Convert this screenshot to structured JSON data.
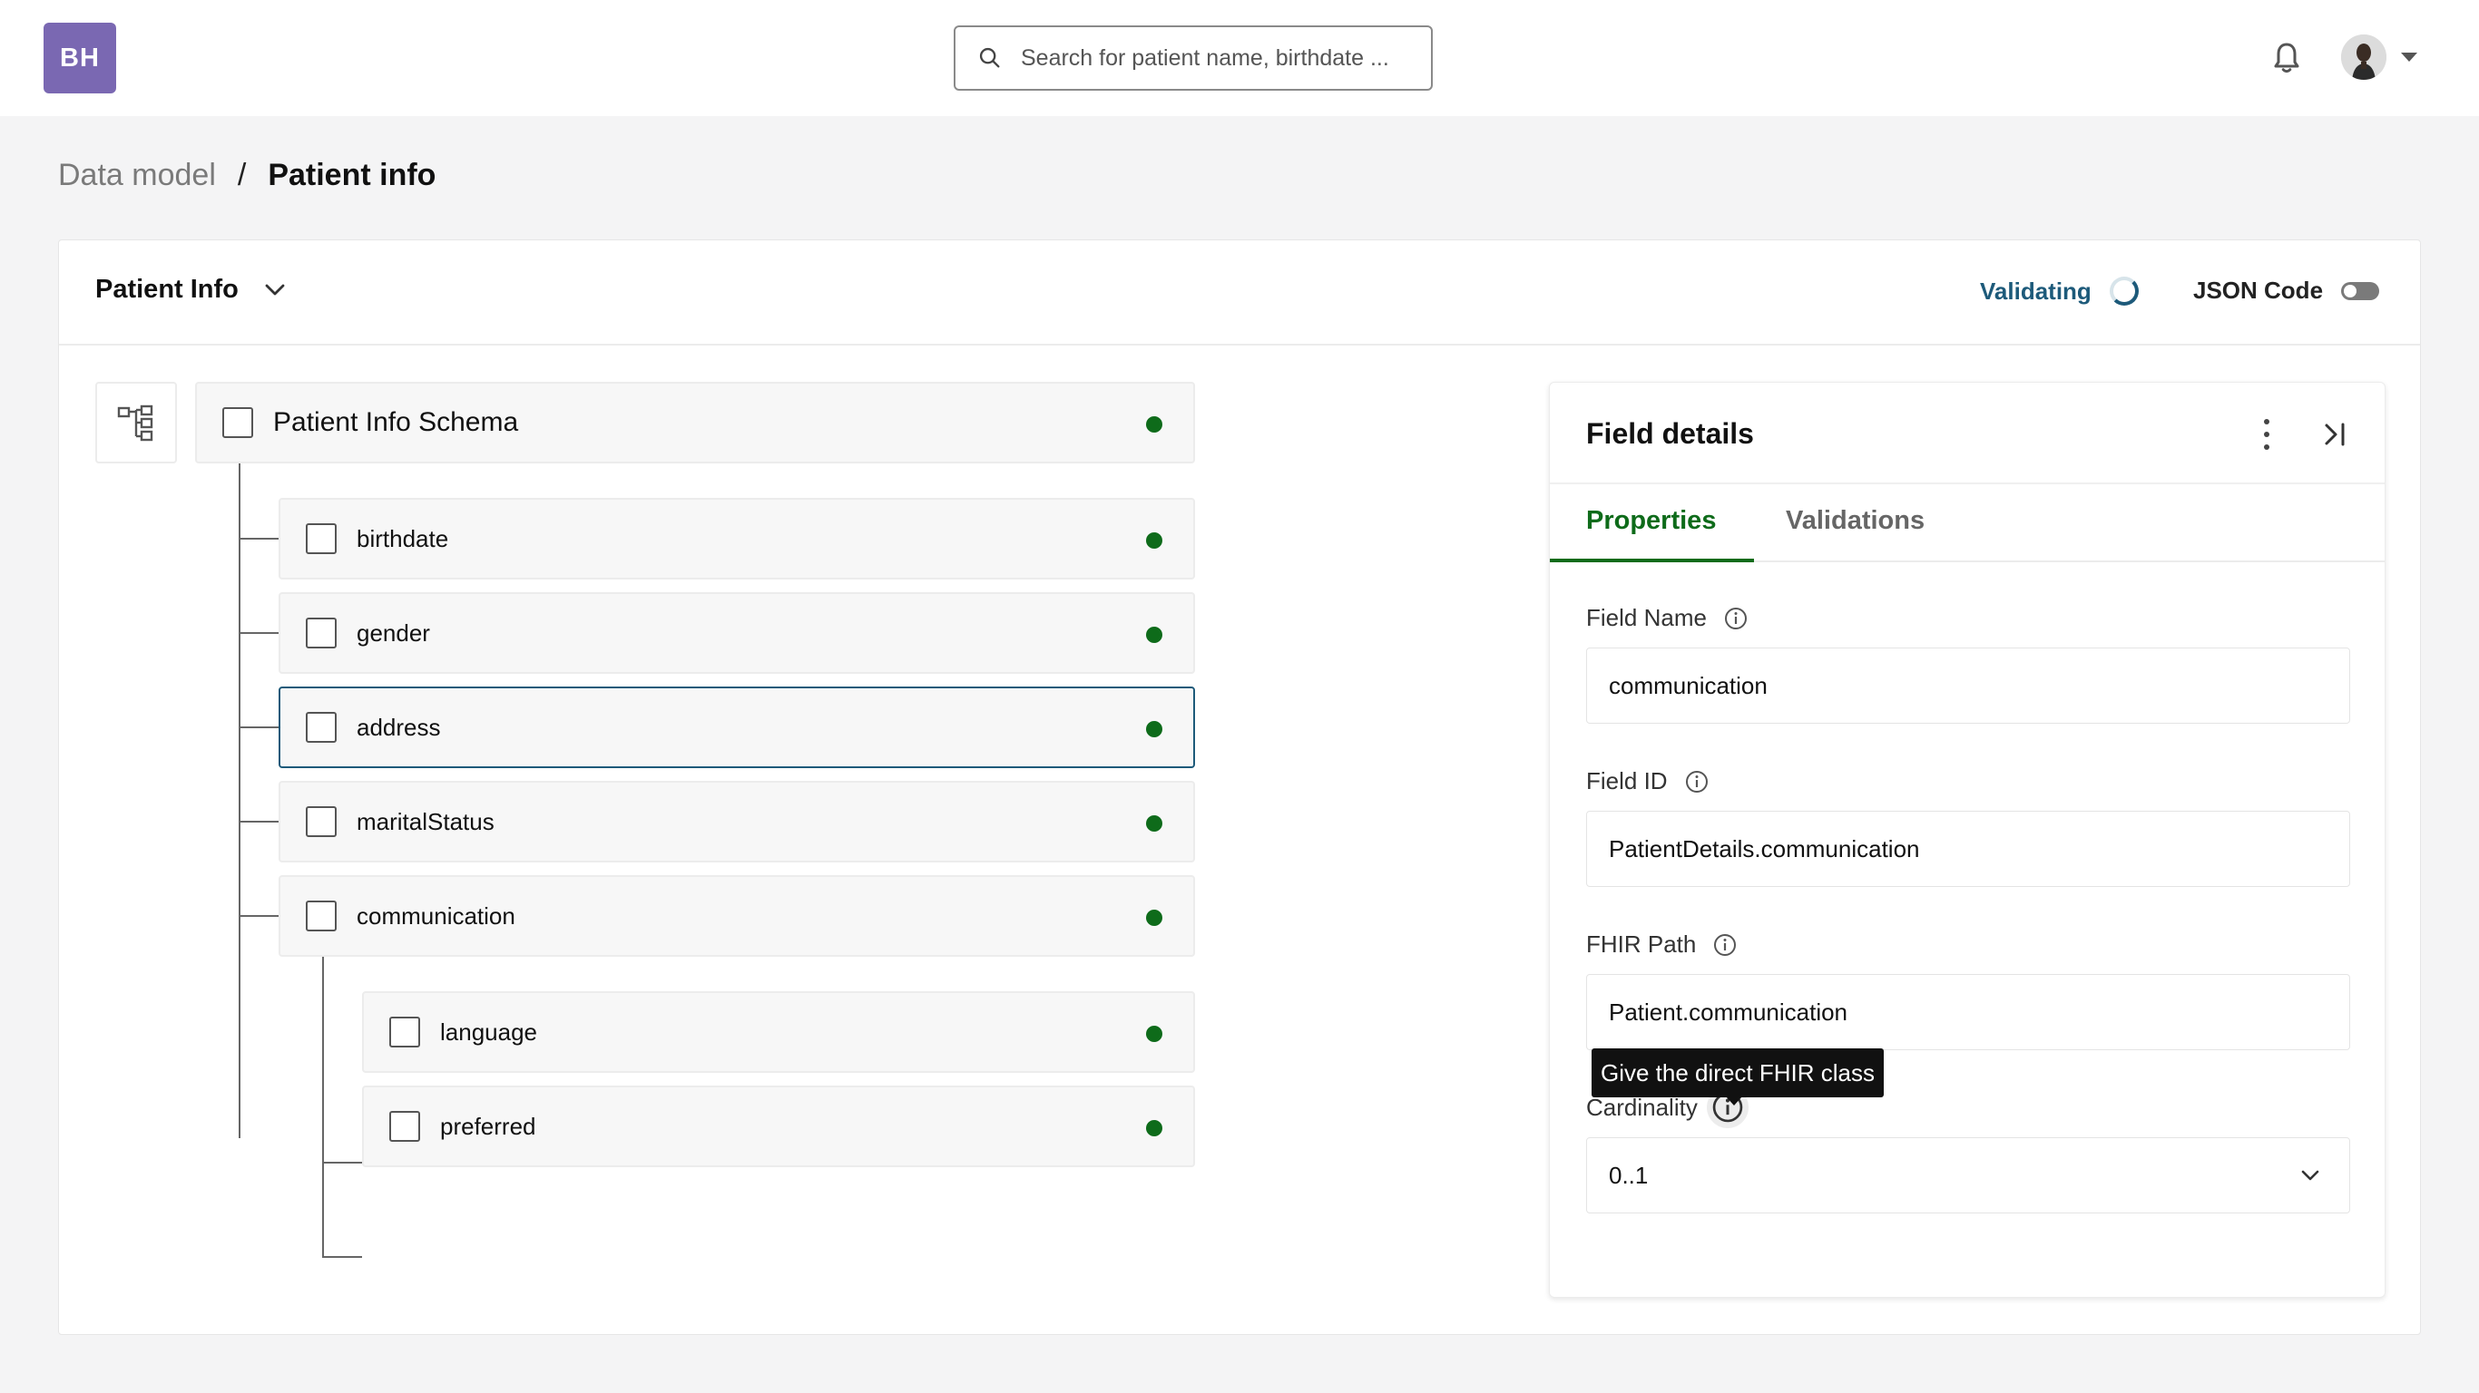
{
  "header": {
    "logo_text": "BH",
    "search_placeholder": "Search for patient name, birthdate ...",
    "bell_icon": "bell-icon",
    "avatar_icon": "user-avatar"
  },
  "breadcrumb": {
    "parent": "Data model",
    "separator": "/",
    "current": "Patient info"
  },
  "toolbar": {
    "schema_name": "Patient Info",
    "validating_label": "Validating",
    "json_code_label": "JSON Code",
    "json_code_enabled": false
  },
  "tree": {
    "root": {
      "label": "Patient Info Schema",
      "status_color": "#0e6b1a"
    },
    "children": [
      {
        "label": "birthdate",
        "status_color": "#0e6b1a"
      },
      {
        "label": "gender",
        "status_color": "#0e6b1a"
      },
      {
        "label": "address",
        "status_color": "#0e6b1a",
        "selected": true
      },
      {
        "label": "maritalStatus",
        "status_color": "#0e6b1a"
      },
      {
        "label": "communication",
        "status_color": "#0e6b1a"
      }
    ],
    "grandchildren": [
      {
        "label": "language",
        "status_color": "#0e6b1a"
      },
      {
        "label": "preferred",
        "status_color": "#0e6b1a"
      }
    ]
  },
  "panel": {
    "title": "Field details",
    "tabs": [
      {
        "label": "Properties",
        "active": true
      },
      {
        "label": "Validations",
        "active": false
      }
    ],
    "fields": {
      "field_name": {
        "label": "Field Name",
        "value": "communication"
      },
      "field_id": {
        "label": "Field ID",
        "value": "PatientDetails.communication"
      },
      "fhir_path": {
        "label": "FHIR Path",
        "value": "Patient.communication"
      },
      "cardinality": {
        "label": "Cardinality",
        "value": "0..1"
      }
    },
    "tooltip": "Give the direct FHIR class"
  },
  "colors": {
    "brand": "#7a68b2",
    "accent_green": "#0e6b1a",
    "accent_blue": "#1d5a7a"
  }
}
